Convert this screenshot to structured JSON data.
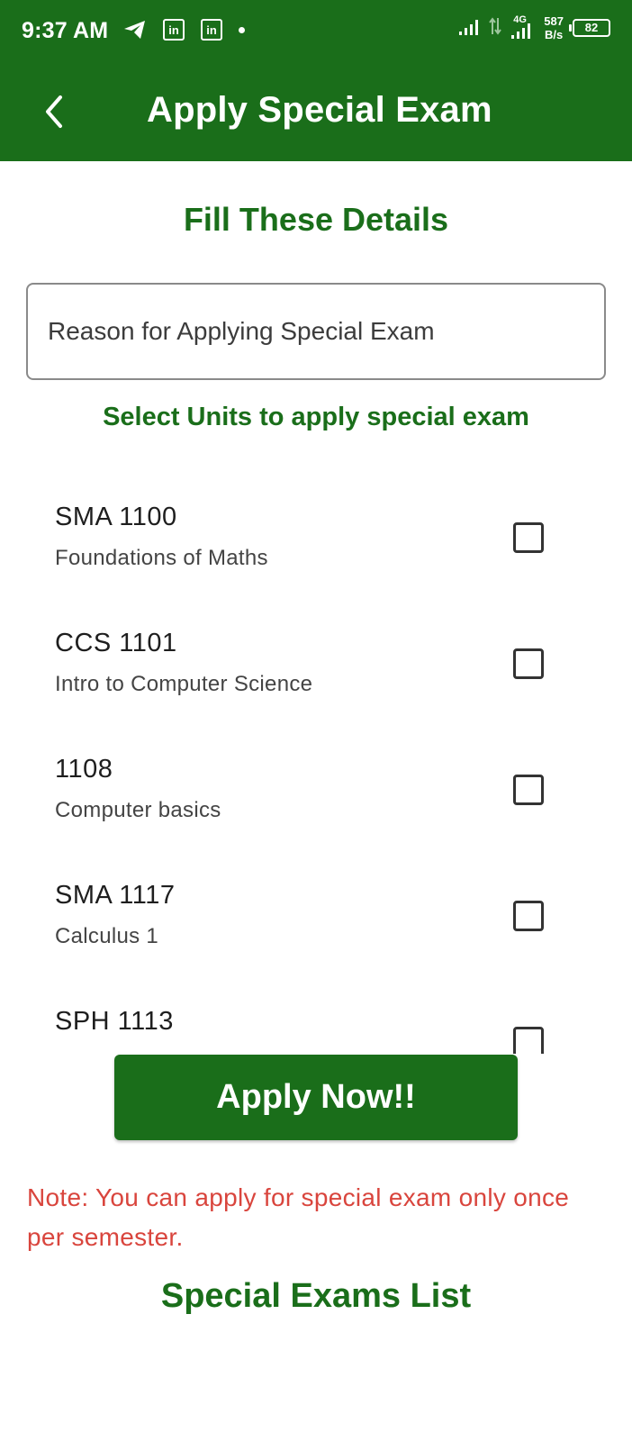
{
  "status_bar": {
    "time": "9:37 AM",
    "network_type": "4G",
    "net_speed_value": "587",
    "net_speed_unit": "B/s",
    "battery": "82"
  },
  "app_bar": {
    "title": "Apply Special Exam"
  },
  "form": {
    "heading": "Fill These Details",
    "reason_placeholder": "Reason for Applying Special Exam",
    "reason_value": "",
    "units_heading": "Select Units to apply special exam",
    "units": [
      {
        "code": "SMA 1100",
        "name": "Foundations of Maths",
        "checked": false
      },
      {
        "code": "CCS 1101",
        "name": "Intro to Computer Science",
        "checked": false
      },
      {
        "code": "1108",
        "name": "Computer basics",
        "checked": false
      },
      {
        "code": "SMA 1117",
        "name": "Calculus 1",
        "checked": false
      },
      {
        "code": "SPH 1113",
        "name": "",
        "checked": false
      }
    ],
    "apply_label": "Apply Now!!",
    "note": "Note: You can apply for special exam only once per semester."
  },
  "special_exams": {
    "heading": "Special Exams List"
  },
  "colors": {
    "primary": "#1a6e1a",
    "note": "#d9453d"
  }
}
